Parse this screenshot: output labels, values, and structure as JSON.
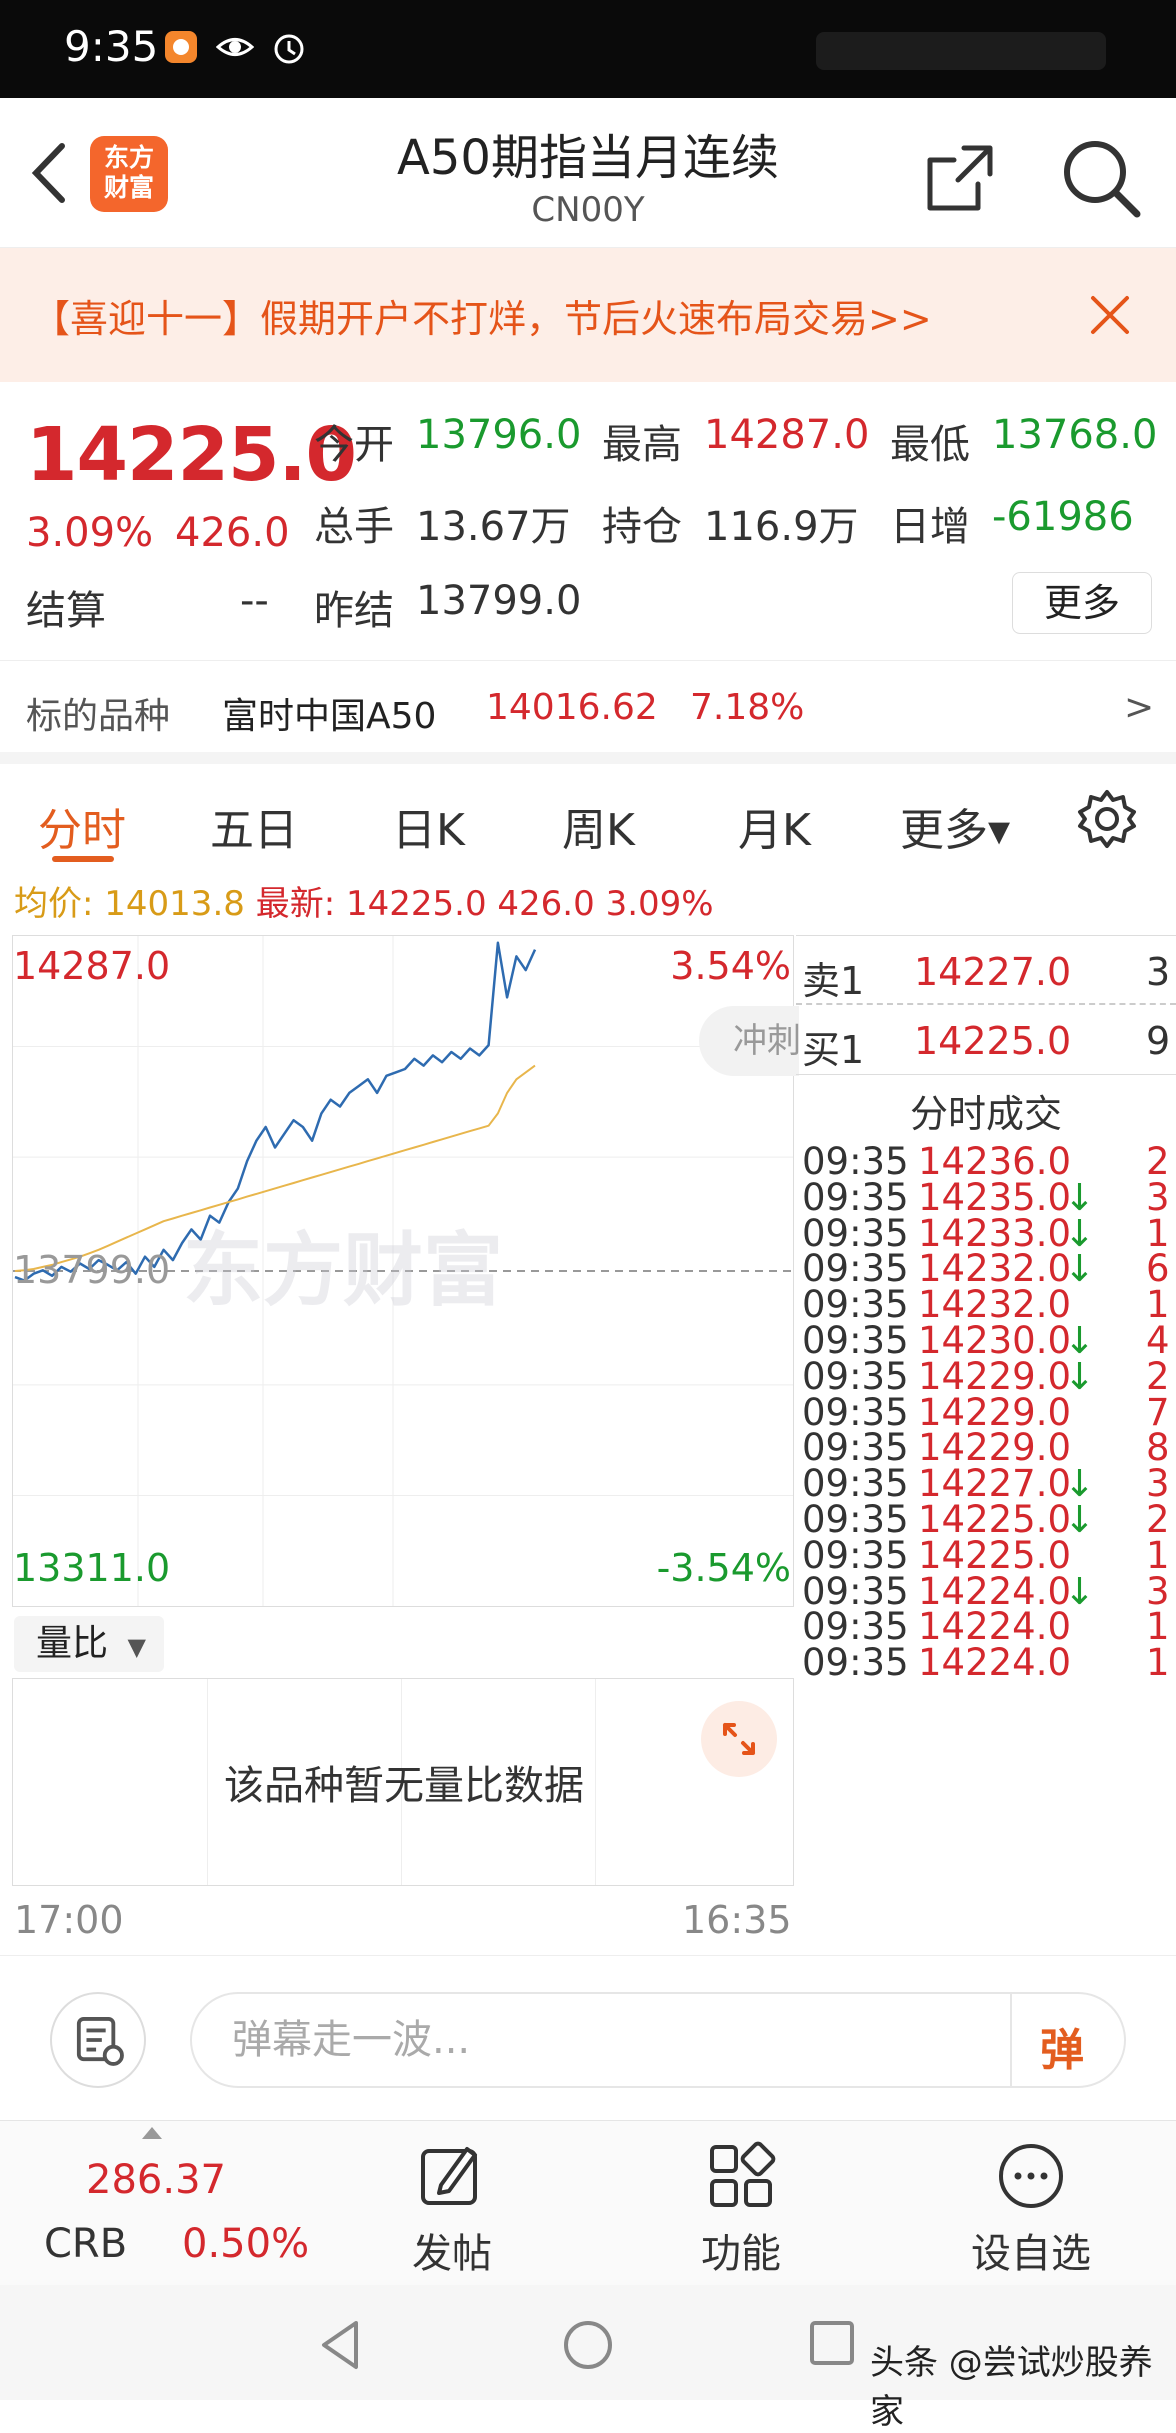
{
  "status_bar": {
    "time": "9:35"
  },
  "header": {
    "title": "A50期指当月连续",
    "subtitle": "CN00Y",
    "logo_text_1": "东方",
    "logo_text_2": "财富"
  },
  "banner": {
    "text": "【喜迎十一】假期开户不打烊，节后火速布局交易>>"
  },
  "quote": {
    "price": "14225.0",
    "change_pct": "3.09%",
    "change_abs": "426.0",
    "open_label": "今开",
    "open": "13796.0",
    "high_label": "最高",
    "high": "14287.0",
    "low_label": "最低",
    "low": "13768.0",
    "volume_label": "总手",
    "volume": "13.67万",
    "oi_label": "持仓",
    "oi": "116.9万",
    "daily_inc_label": "日增",
    "daily_inc": "-61986",
    "settle_label": "结算",
    "settle": "--",
    "prev_settle_label": "昨结",
    "prev_settle": "13799.0",
    "more_label": "更多",
    "underlying_label": "标的品种",
    "underlying_name": "富时中国A50",
    "underlying_price": "14016.62",
    "underlying_pct": "7.18%",
    "underlying_arrow": ">"
  },
  "tabs": [
    {
      "label": "分时"
    },
    {
      "label": "五日"
    },
    {
      "label": "日K"
    },
    {
      "label": "周K"
    },
    {
      "label": "月K"
    },
    {
      "label": "更多▾"
    }
  ],
  "avg_line": {
    "avg_label": "均价:",
    "avg": "14013.8",
    "latest_label": "最新:",
    "latest": "14225.0",
    "chg": "426.0",
    "pct": "3.09%"
  },
  "chart": {
    "ymax_label": "14287.0",
    "ymax_pct": "3.54%",
    "base_label": "13799.0",
    "ymin_label": "13311.0",
    "ymin_pct": "-3.54%",
    "watermark": "东方财富",
    "pill_text": "冲刺",
    "time_start": "17:00",
    "time_end": "16:35"
  },
  "chart_data": {
    "type": "line",
    "ylim": [
      13311.0,
      14287.0
    ],
    "series": [
      {
        "name": "",
        "color": "#2e6bb0",
        "values": [
          13790,
          13785,
          13795,
          13800,
          13792,
          13805,
          13798,
          13810,
          13802,
          13815,
          13808,
          13800,
          13812,
          13795,
          13820,
          13805,
          13830,
          13815,
          13840,
          13860,
          13845,
          13880,
          13870,
          13900,
          13920,
          13960,
          13990,
          14010,
          13980,
          14000,
          14020,
          14010,
          13990,
          14030,
          14050,
          14040,
          14060,
          14070,
          14080,
          14060,
          14085,
          14090,
          14095,
          14110,
          14100,
          14115,
          14105,
          14120,
          14110,
          14125,
          14115,
          14130,
          14280,
          14200,
          14260,
          14240,
          14270
        ]
      },
      {
        "name": "",
        "color": "#e8b64c",
        "values": [
          13799,
          13800,
          13802,
          13805,
          13808,
          13812,
          13816,
          13820,
          13825,
          13830,
          13836,
          13842,
          13848,
          13854,
          13860,
          13866,
          13872,
          13876,
          13880,
          13884,
          13888,
          13892,
          13896,
          13900,
          13904,
          13908,
          13912,
          13916,
          13920,
          13924,
          13928,
          13932,
          13936,
          13940,
          13944,
          13948,
          13952,
          13956,
          13960,
          13964,
          13968,
          13972,
          13976,
          13980,
          13984,
          13988,
          13992,
          13996,
          14000,
          14004,
          14008,
          14012,
          14030,
          14060,
          14080,
          14090,
          14100
        ]
      }
    ]
  },
  "volume_ratio": {
    "select": "量比",
    "no_data": "该品种暂无量比数据"
  },
  "order_book": {
    "ask_label": "卖1",
    "ask_price": "14227.0",
    "ask_vol": "3",
    "bid_label": "买1",
    "bid_price": "14225.0",
    "bid_vol": "9",
    "trades_title": "分时成交",
    "trades": [
      {
        "time": "09:35",
        "price": "14236.0",
        "arrow": "",
        "vol": "2"
      },
      {
        "time": "09:35",
        "price": "14235.0",
        "arrow": "↓",
        "vol": "3"
      },
      {
        "time": "09:35",
        "price": "14233.0",
        "arrow": "↓",
        "vol": "1"
      },
      {
        "time": "09:35",
        "price": "14232.0",
        "arrow": "↓",
        "vol": "6"
      },
      {
        "time": "09:35",
        "price": "14232.0",
        "arrow": "",
        "vol": "1"
      },
      {
        "time": "09:35",
        "price": "14230.0",
        "arrow": "↓",
        "vol": "4"
      },
      {
        "time": "09:35",
        "price": "14229.0",
        "arrow": "↓",
        "vol": "2"
      },
      {
        "time": "09:35",
        "price": "14229.0",
        "arrow": "",
        "vol": "7"
      },
      {
        "time": "09:35",
        "price": "14229.0",
        "arrow": "",
        "vol": "8"
      },
      {
        "time": "09:35",
        "price": "14227.0",
        "arrow": "↓",
        "vol": "3"
      },
      {
        "time": "09:35",
        "price": "14225.0",
        "arrow": "↓",
        "vol": "2"
      },
      {
        "time": "09:35",
        "price": "14225.0",
        "arrow": "",
        "vol": "1"
      },
      {
        "time": "09:35",
        "price": "14224.0",
        "arrow": "↓",
        "vol": "3"
      },
      {
        "time": "09:35",
        "price": "14224.0",
        "arrow": "",
        "vol": "1"
      },
      {
        "time": "09:35",
        "price": "14224.0",
        "arrow": "",
        "vol": "1"
      }
    ]
  },
  "comment_bar": {
    "placeholder": "弹幕走一波...",
    "send_label": "弹"
  },
  "bottom_nav": {
    "crb_value": "286.37",
    "crb_label": "CRB",
    "crb_pct": "0.50%",
    "post": "发帖",
    "func": "功能",
    "watchlist": "设自选"
  },
  "credit": "头条 @尝试炒股养家"
}
